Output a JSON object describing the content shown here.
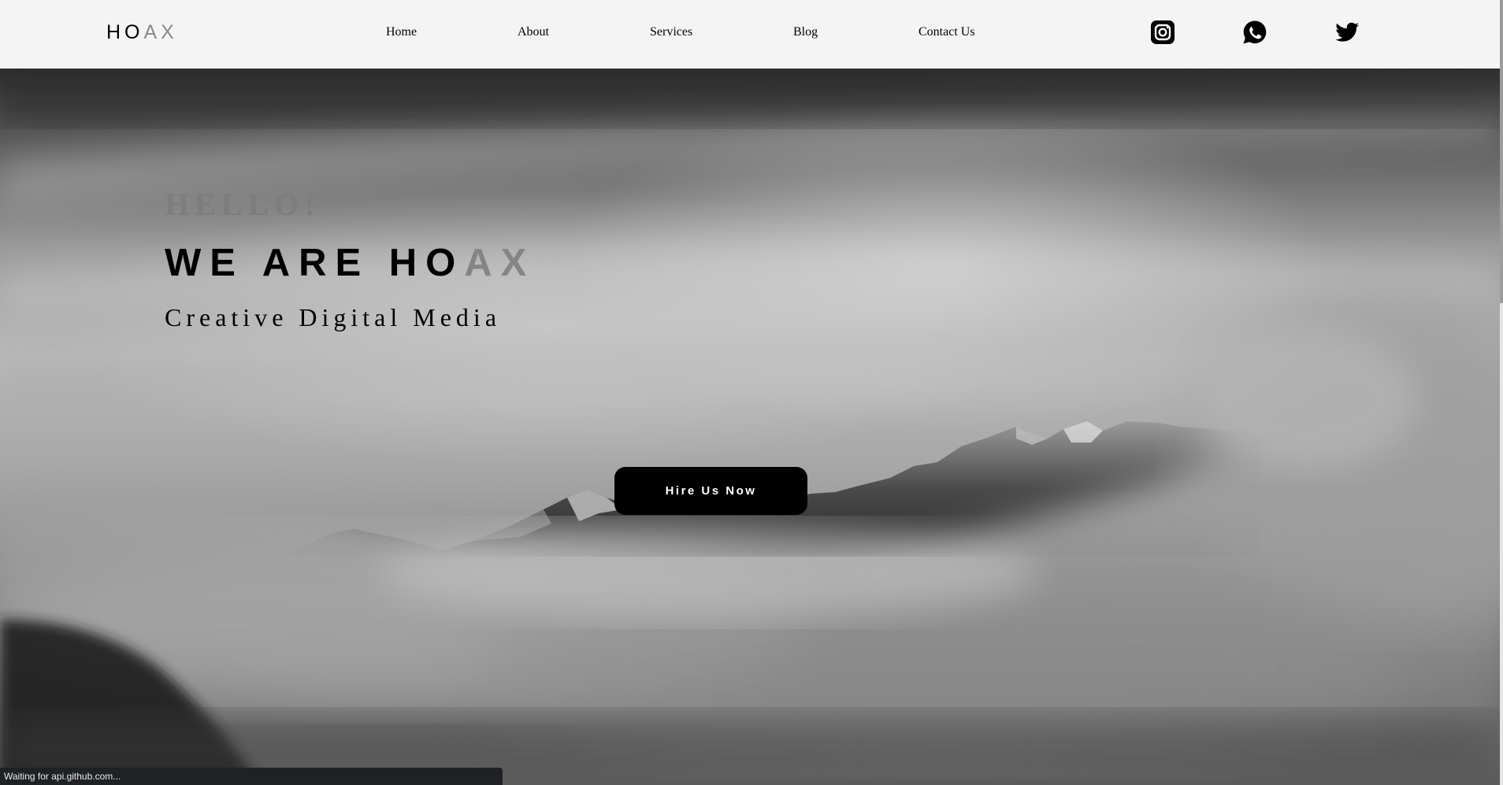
{
  "header": {
    "logo_dark": "HO",
    "logo_light": "AX",
    "nav": [
      {
        "label": "Home"
      },
      {
        "label": "About"
      },
      {
        "label": "Services"
      },
      {
        "label": "Blog"
      },
      {
        "label": "Contact Us"
      }
    ],
    "social": [
      {
        "icon": "instagram-icon"
      },
      {
        "icon": "whatsapp-icon"
      },
      {
        "icon": "twitter-icon"
      }
    ]
  },
  "hero": {
    "greeting": "HELLO!",
    "headline_dark": "WE ARE HO",
    "headline_light": "AX",
    "tagline": "Creative Digital Media",
    "cta_label": "Hire Us Now"
  },
  "browser": {
    "status_text": "Waiting for api.github.com..."
  },
  "colors": {
    "accent_gray": "#858585",
    "header_bg": "#f4f4f4",
    "button_bg": "#000000",
    "button_text": "#ffffff"
  }
}
